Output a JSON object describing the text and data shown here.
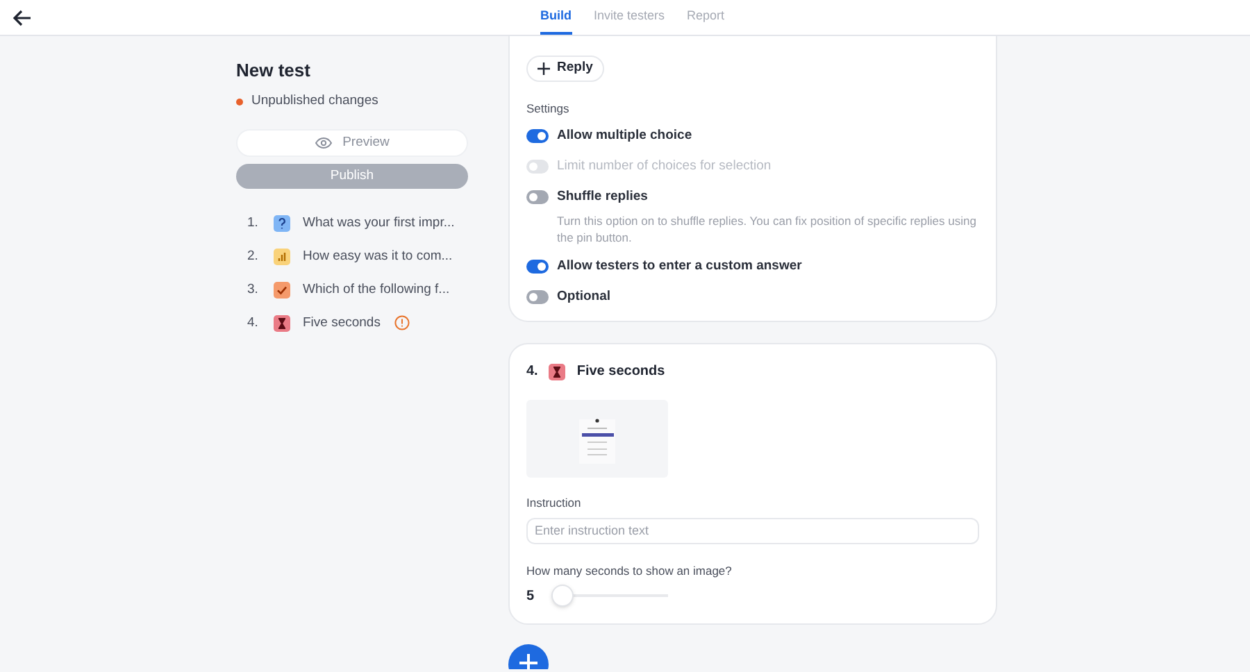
{
  "tabs": [
    {
      "label": "Build",
      "selected": true
    },
    {
      "label": "Invite testers",
      "selected": false
    },
    {
      "label": "Report",
      "selected": false
    }
  ],
  "test": {
    "title": "New test",
    "status": "Unpublished changes",
    "preview_button": "Preview",
    "publish_button": "Publish"
  },
  "questions": [
    {
      "number": "1.",
      "kind": "question",
      "title": "What was your first impr...",
      "warning": false
    },
    {
      "number": "2.",
      "kind": "rating",
      "title": "How easy was it to com...",
      "warning": false
    },
    {
      "number": "3.",
      "kind": "choice",
      "title": "Which of the following f...",
      "warning": false
    },
    {
      "number": "4.",
      "kind": "timer",
      "title": "Five seconds",
      "warning": true
    }
  ],
  "choice_card": {
    "reply_button": "Reply",
    "settings_label": "Settings",
    "settings": [
      {
        "label": "Allow multiple choice",
        "on": true,
        "disabled": false
      },
      {
        "label": "Limit number of choices for selection",
        "on": false,
        "disabled": true
      },
      {
        "label": "Shuffle replies",
        "on": false,
        "disabled": false,
        "description": "Turn this option on to shuffle replies. You can fix position of specific replies using the pin button."
      },
      {
        "label": "Allow testers to enter a custom answer",
        "on": true,
        "disabled": false
      },
      {
        "label": "Optional",
        "on": false,
        "disabled": false
      }
    ]
  },
  "five_seconds_card": {
    "number": "4.",
    "kind": "timer",
    "title": "Five seconds",
    "instruction_label": "Instruction",
    "instruction_placeholder": "Enter instruction text",
    "duration_label": "How many seconds to show an image?",
    "duration_value": "5",
    "duration_slider": {
      "level": 0
    }
  }
}
